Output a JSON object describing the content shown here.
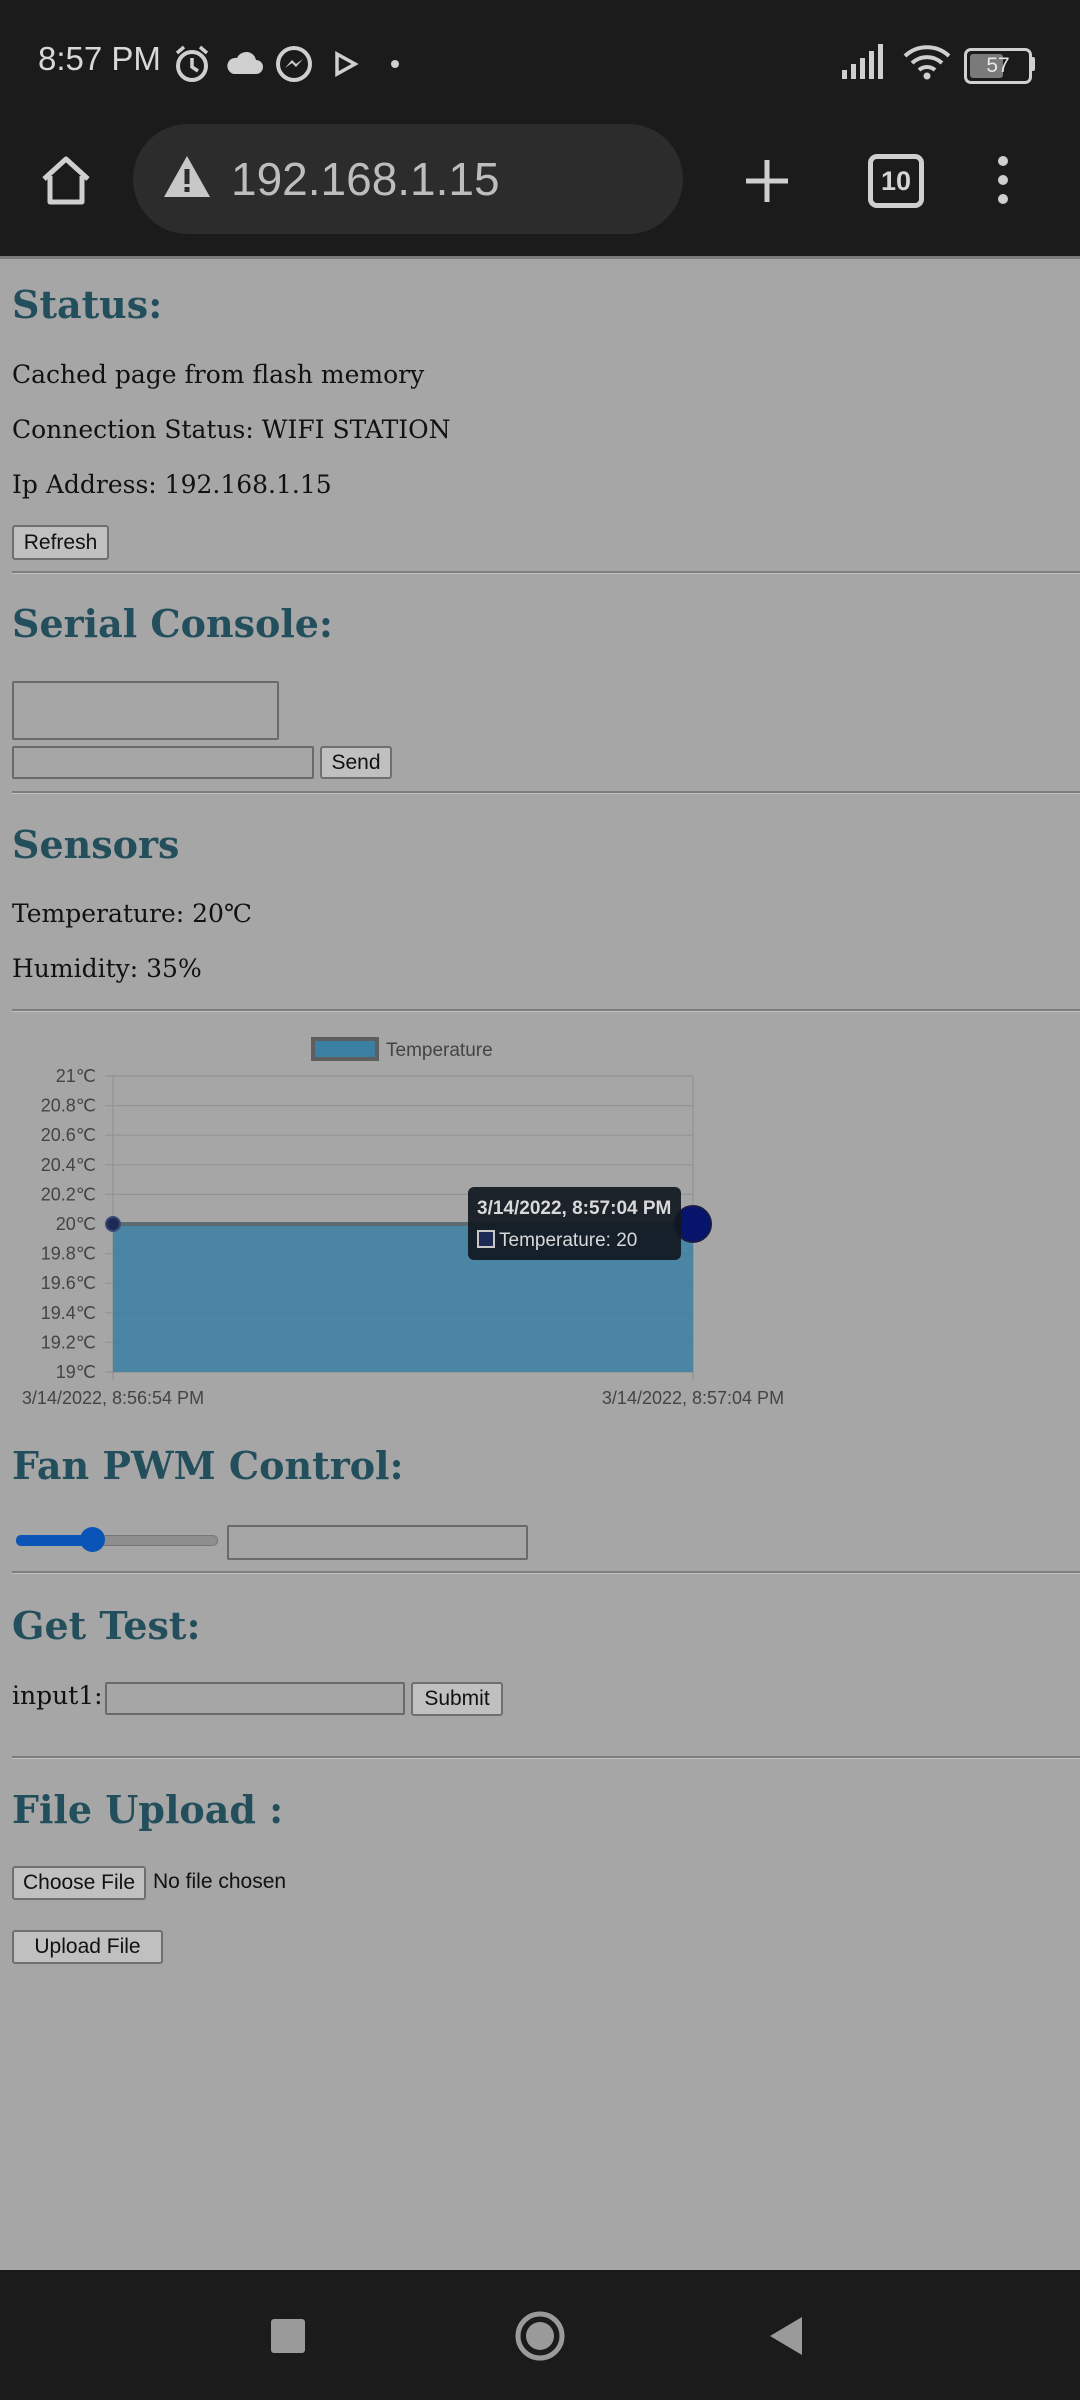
{
  "status_bar": {
    "time": "8:57 PM",
    "battery": "57",
    "icons": [
      "alarm-icon",
      "cloud-icon",
      "messenger-icon",
      "play-icon",
      "dot-icon",
      "signal-icon",
      "wifi-icon",
      "battery-icon"
    ]
  },
  "browser": {
    "url": "192.168.1.15",
    "tab_count": "10"
  },
  "status": {
    "heading": "Status:",
    "cached": "Cached page from flash memory",
    "connection": "Connection Status: WIFI STATION",
    "ip": "Ip Address: 192.168.1.15",
    "refresh_label": "Refresh"
  },
  "serial": {
    "heading": "Serial Console:",
    "send_label": "Send"
  },
  "sensors": {
    "heading": "Sensors",
    "temperature": "Temperature: 20℃",
    "humidity": "Humidity: 35%"
  },
  "chart_data": {
    "type": "area",
    "series": [
      {
        "name": "Temperature",
        "x": [
          "3/14/2022, 8:56:54 PM",
          "3/14/2022, 8:57:04 PM"
        ],
        "values": [
          20,
          20
        ],
        "color": "#3b7fa3"
      }
    ],
    "yticks": [
      "21℃",
      "20.8℃",
      "20.6℃",
      "20.4℃",
      "20.2℃",
      "20℃",
      "19.8℃",
      "19.6℃",
      "19.4℃",
      "19.2℃",
      "19℃"
    ],
    "xticks": [
      "3/14/2022, 8:56:54 PM",
      "3/14/2022, 8:57:04 PM"
    ],
    "ylim": [
      19,
      21
    ],
    "legend": "top",
    "tooltip": {
      "title": "3/14/2022, 8:57:04 PM",
      "body": "Temperature: 20"
    }
  },
  "fan": {
    "heading": "Fan PWM Control:",
    "slider_value": 0.38
  },
  "gettest": {
    "heading": "Get Test:",
    "input_label": "input1:",
    "submit_label": "Submit"
  },
  "upload": {
    "heading": "File Upload :",
    "choose_label": "Choose File",
    "no_file": "No file chosen",
    "upload_label": "Upload File"
  }
}
